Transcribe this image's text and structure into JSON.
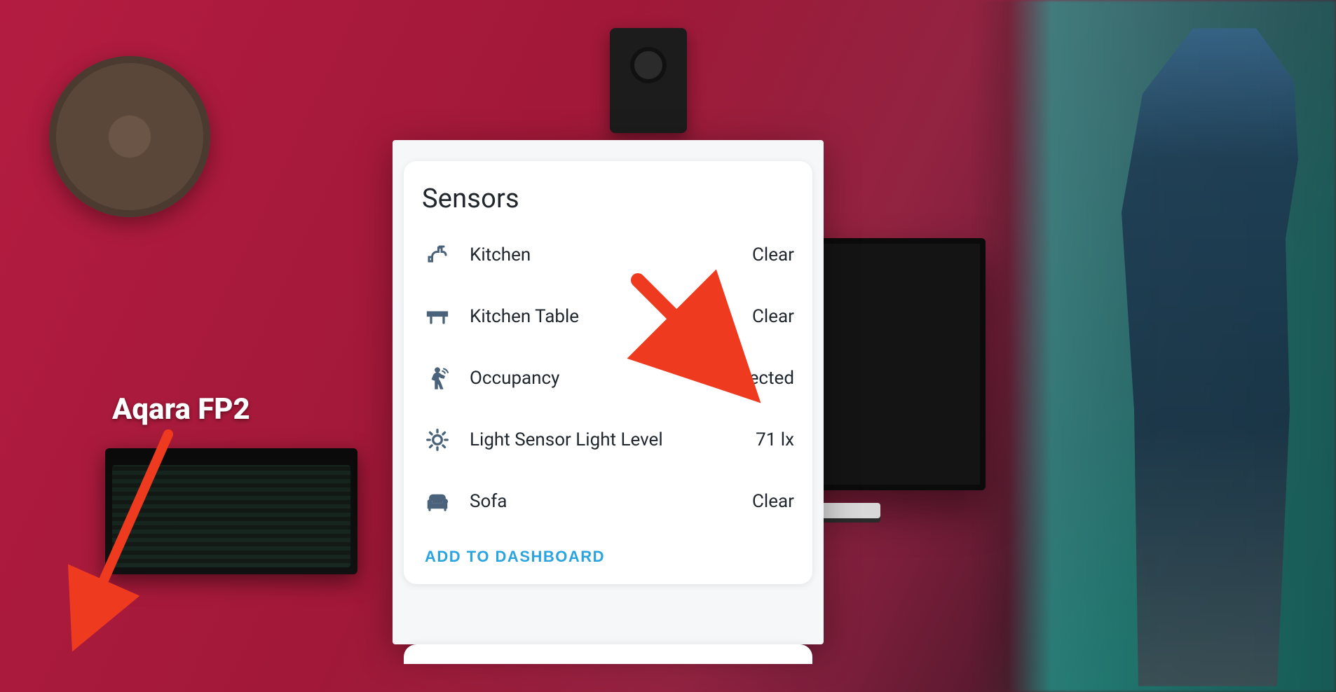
{
  "annotation": {
    "device_label": "Aqara FP2"
  },
  "card": {
    "title": "Sensors",
    "rows": [
      {
        "icon": "faucet-icon",
        "label": "Kitchen",
        "value": "Clear"
      },
      {
        "icon": "table-icon",
        "label": "Kitchen Table",
        "value": "Clear"
      },
      {
        "icon": "motion-icon",
        "label": "Occupancy",
        "value": "Detected"
      },
      {
        "icon": "sun-icon",
        "label": "Light Sensor Light Level",
        "value": "71 lx"
      },
      {
        "icon": "sofa-icon",
        "label": "Sofa",
        "value": "Clear"
      }
    ],
    "action_label": "ADD TO DASHBOARD"
  },
  "colors": {
    "accent": "#2aa4e0",
    "icon": "#4a637a",
    "arrow": "#ee3a1f"
  }
}
